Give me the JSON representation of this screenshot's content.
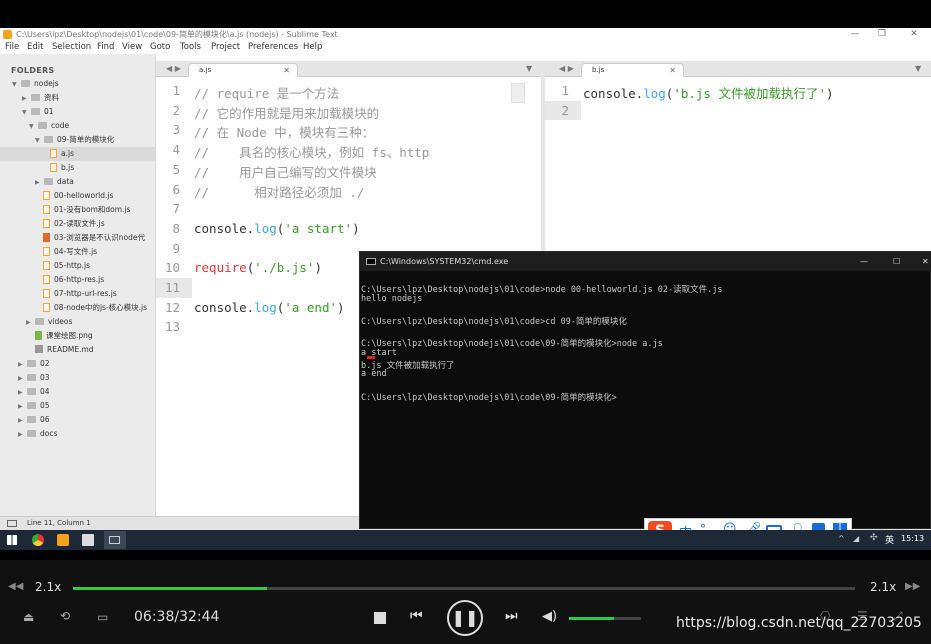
{
  "window": {
    "title": "C:\\Users\\lpz\\Desktop\\nodejs\\01\\code\\09-简单的模块化\\a.js (nodejs) - Sublime Text",
    "menu": [
      "File",
      "Edit",
      "Selection",
      "Find",
      "View",
      "Goto",
      "Tools",
      "Project",
      "Preferences",
      "Help"
    ],
    "controls": {
      "minimize": "—",
      "maximize": "❐",
      "close": "✕"
    }
  },
  "sidebar": {
    "header": "FOLDERS",
    "items": [
      "nodejs",
      "资料",
      "01",
      "code",
      "09-简单的模块化",
      "a.js",
      "b.js",
      "data",
      "00-helloworld.js",
      "01-没有bom和dom.js",
      "02-读取文件.js",
      "03-浏览器是不认识node代",
      "04-写文件.js",
      "05-http.js",
      "06-http-res.js",
      "07-http-url-res.js",
      "08-node中的js-核心模块.js",
      "videos",
      "课堂绘图.png",
      "README.md",
      "02",
      "03",
      "04",
      "05",
      "06",
      "docs"
    ]
  },
  "left_editor": {
    "tab": "a.js",
    "lines": [
      "// require 是一个方法",
      "// 它的作用就是用来加载模块的",
      "// 在 Node 中，模块有三种：",
      "//    具名的核心模块，例如 fs、http",
      "//    用户自己编写的文件模块",
      "//      相对路径必须加 ./",
      "",
      "console.log('a start')",
      "",
      "require('./b.js')",
      "",
      "console.log('a end')",
      ""
    ],
    "line_numbers": [
      "1",
      "2",
      "3",
      "4",
      "5",
      "6",
      "7",
      "8",
      "9",
      "10",
      "11",
      "12",
      "13"
    ]
  },
  "right_editor": {
    "tab": "b.js",
    "lines": [
      "console.log('b.js 文件被加载执行了')",
      ""
    ],
    "line_numbers": [
      "1",
      "2"
    ]
  },
  "statusbar": {
    "position": "Line 11, Column 1"
  },
  "cmd": {
    "title": "C:\\Windows\\SYSTEM32\\cmd.exe",
    "lines": [
      "C:\\Users\\lpz\\Desktop\\nodejs\\01\\code>node 00-helloworld.js 02-读取文件.js",
      "hello nodejs",
      "",
      "C:\\Users\\lpz\\Desktop\\nodejs\\01\\code>cd 09-简单的模块化",
      "",
      "C:\\Users\\lpz\\Desktop\\nodejs\\01\\code\\09-简单的模块化>node a.js",
      "a start",
      "b.js 文件被加载执行了",
      "a end",
      "",
      "C:\\Users\\lpz\\Desktop\\nodejs\\01\\code\\09-简单的模块化>"
    ]
  },
  "taskbar": {
    "ime": "中",
    "lang": "英",
    "time": "15:13"
  },
  "player": {
    "speed_left": "2.1x",
    "speed_right": "2.1x",
    "time": "06:38/32:44",
    "progress": 0.248,
    "volume": 0.62,
    "watermark": "https://blog.csdn.net/qq_22703205"
  }
}
